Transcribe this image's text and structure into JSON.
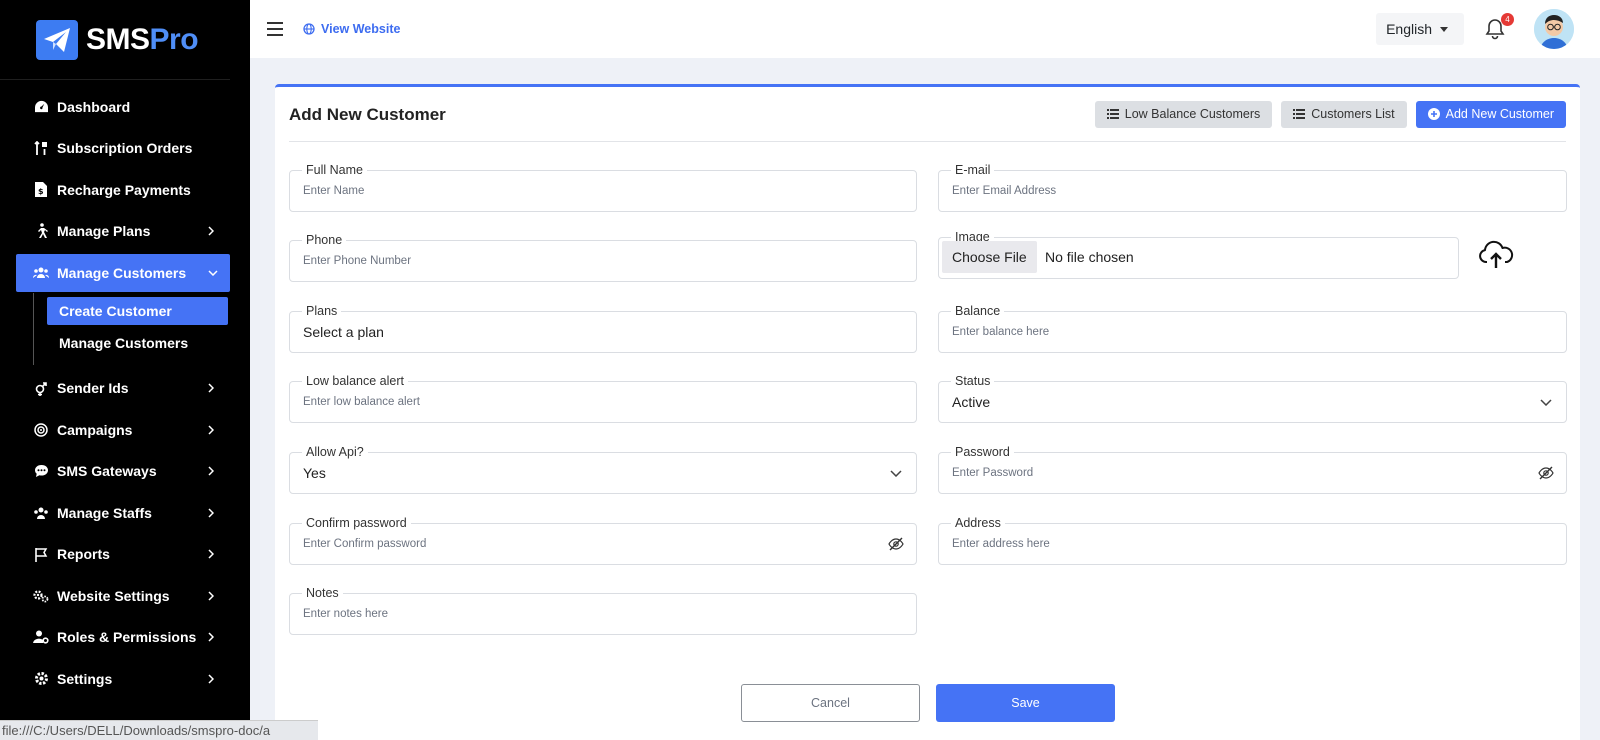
{
  "brand": {
    "name_part1": "SMS",
    "name_part2": "Pro"
  },
  "sidebar": {
    "items": [
      {
        "label": "Dashboard",
        "icon": "gauge-icon",
        "has_children": false
      },
      {
        "label": "Subscription Orders",
        "icon": "sort-arrows-icon",
        "has_children": false
      },
      {
        "label": "Recharge Payments",
        "icon": "invoice-dollar-icon",
        "has_children": false
      },
      {
        "label": "Manage Plans",
        "icon": "person-walking-icon",
        "has_children": true
      },
      {
        "label": "Manage Customers",
        "icon": "users-icon",
        "has_children": true,
        "expanded": true,
        "children": [
          {
            "label": "Create Customer",
            "active": true
          },
          {
            "label": "Manage Customers",
            "active": false
          }
        ]
      },
      {
        "label": "Sender Ids",
        "icon": "venus-mars-icon",
        "has_children": true
      },
      {
        "label": "Campaigns",
        "icon": "target-icon",
        "has_children": true
      },
      {
        "label": "SMS Gateways",
        "icon": "comment-dots-icon",
        "has_children": true
      },
      {
        "label": "Manage Staffs",
        "icon": "people-group-icon",
        "has_children": true
      },
      {
        "label": "Reports",
        "icon": "flag-icon",
        "has_children": true
      },
      {
        "label": "Website Settings",
        "icon": "gears-icon",
        "has_children": true
      },
      {
        "label": "Roles & Permissions",
        "icon": "user-gear-icon",
        "has_children": true
      },
      {
        "label": "Settings",
        "icon": "gear-icon",
        "has_children": true
      }
    ]
  },
  "topbar": {
    "view_website": "View Website",
    "language": "English",
    "notifications_count": "4"
  },
  "page": {
    "title": "Add New Customer",
    "buttons": {
      "low_balance": "Low Balance Customers",
      "customers_list": "Customers List",
      "add_new": "Add New Customer"
    }
  },
  "form": {
    "full_name": {
      "label": "Full Name",
      "placeholder": "Enter Name"
    },
    "email": {
      "label": "E-mail",
      "placeholder": "Enter Email Address"
    },
    "phone": {
      "label": "Phone",
      "placeholder": "Enter Phone Number"
    },
    "image": {
      "label": "Image",
      "button": "Choose File",
      "status": "No file chosen"
    },
    "plans": {
      "label": "Plans",
      "value": "Select a plan"
    },
    "balance": {
      "label": "Balance",
      "placeholder": "Enter balance here"
    },
    "low_balance_alert": {
      "label": "Low balance alert",
      "placeholder": "Enter low balance alert"
    },
    "status": {
      "label": "Status",
      "value": "Active"
    },
    "allow_api": {
      "label": "Allow Api?",
      "value": "Yes"
    },
    "password": {
      "label": "Password",
      "placeholder": "Enter Password"
    },
    "confirm_password": {
      "label": "Confirm password",
      "placeholder": "Enter Confirm password"
    },
    "address": {
      "label": "Address",
      "placeholder": "Enter address here"
    },
    "notes": {
      "label": "Notes",
      "placeholder": "Enter notes here"
    },
    "cancel": "Cancel",
    "save": "Save"
  },
  "status_bar": {
    "url": "file:///C:/Users/DELL/Downloads/smspro-doc/a"
  },
  "colors": {
    "accent": "#4573f5",
    "sidebar_bg": "#000000",
    "page_bg": "#eef1f7"
  }
}
